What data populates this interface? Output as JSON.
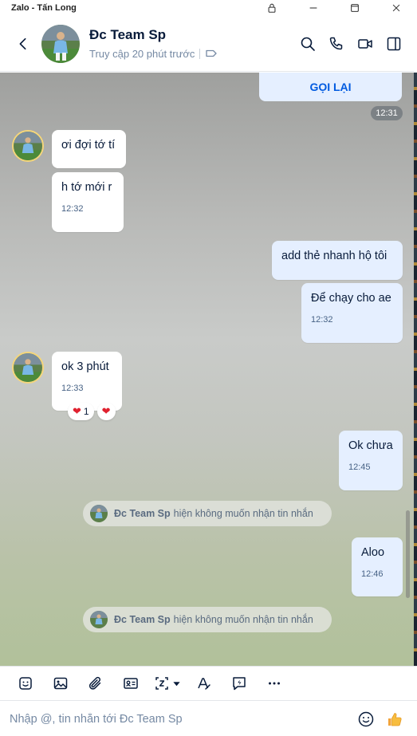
{
  "window": {
    "title": "Zalo - Tấn Long"
  },
  "header": {
    "contact_name": "Đc Team Sp",
    "status": "Truy cập 20 phút trước"
  },
  "recall_label": "GỌI LẠI",
  "recall_time": "12:31",
  "messages": [
    {
      "direction": "in",
      "text": "ơi đợi tớ tí",
      "time": ""
    },
    {
      "direction": "in",
      "text": "h tớ mới r",
      "time": "12:32"
    },
    {
      "direction": "out",
      "text": "add thẻ nhanh hộ tôi",
      "time": ""
    },
    {
      "direction": "out",
      "text": "Để chạy cho ae",
      "time": "12:32"
    },
    {
      "direction": "in",
      "text": "ok 3 phút",
      "time": "12:33"
    },
    {
      "direction": "out",
      "text": "Ok chưa",
      "time": "12:45"
    },
    {
      "direction": "out",
      "text": "Aloo",
      "time": "12:46"
    }
  ],
  "reactions": {
    "heart_count": "1"
  },
  "notices": [
    {
      "name": "Đc Team Sp",
      "text": "hiện không muốn nhận tin nhắn"
    },
    {
      "name": "Đc Team Sp",
      "text": "hiện không muốn nhận tin nhắn"
    }
  ],
  "composer": {
    "placeholder": "Nhập @, tin nhắn tới Đc Team Sp"
  },
  "colors": {
    "accent": "#005ae0",
    "out_bubble": "#e5efff",
    "reaction": "#e0212f"
  },
  "icons": [
    "lock-icon",
    "minimize-icon",
    "maximize-icon",
    "close-icon",
    "back-icon",
    "search-icon",
    "phone-icon",
    "video-icon",
    "sidebar-icon",
    "tag-icon",
    "sticker-icon",
    "image-icon",
    "attach-icon",
    "contact-card-icon",
    "screenshot-icon",
    "format-icon",
    "quick-message-icon",
    "more-icon",
    "emoji-icon",
    "thumbs-up-icon"
  ]
}
